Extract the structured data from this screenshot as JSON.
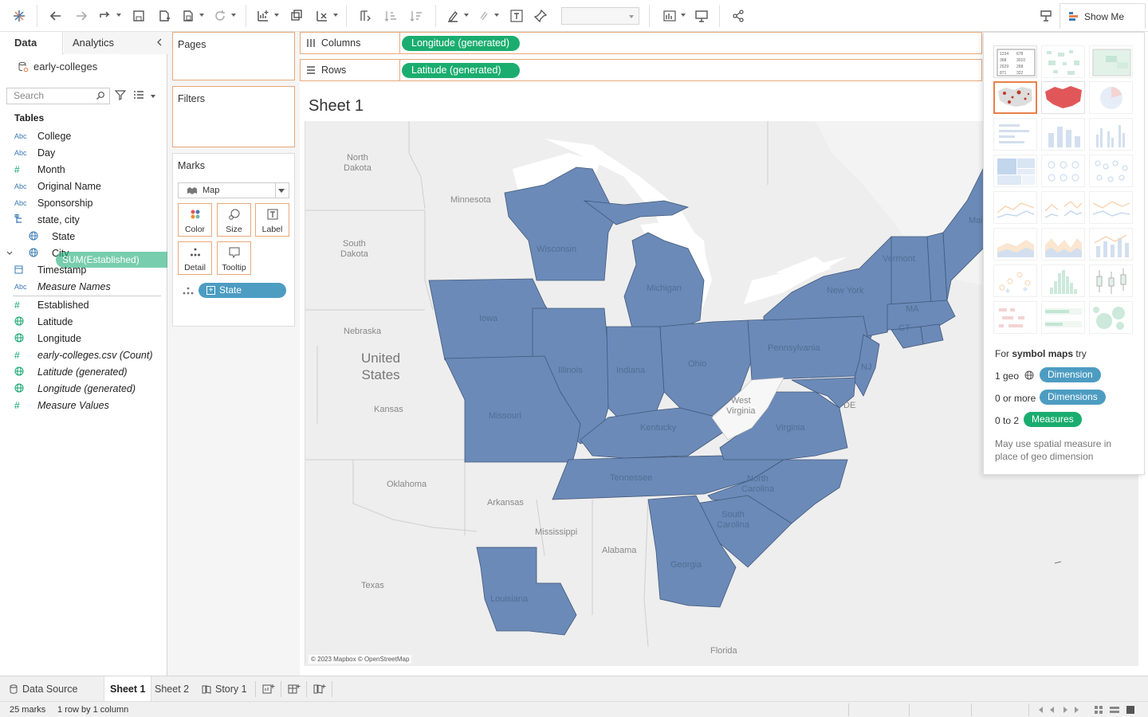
{
  "colors": {
    "accent_orange": "#e8a97a",
    "green_pill": "#1aad6f",
    "blue_pill": "#4d9cc2",
    "state_fill": "#6b8ab8",
    "map_bg": "#eeeeee",
    "water": "#ffffff"
  },
  "toolbar": {
    "show_me_label": "Show Me"
  },
  "data_pane": {
    "tab_data": "Data",
    "tab_analytics": "Analytics",
    "datasource": "early-colleges",
    "search_placeholder": "Search",
    "tables_heading": "Tables",
    "fields": [
      {
        "type": "Abc",
        "name": "College"
      },
      {
        "type": "Abc",
        "name": "Day"
      },
      {
        "type": "#",
        "name": "Month"
      },
      {
        "type": "Abc",
        "name": "Original Name"
      },
      {
        "type": "Abc",
        "name": "Sponsorship"
      },
      {
        "type": "hier",
        "name": "state, city"
      },
      {
        "type": "geo",
        "name": "State"
      },
      {
        "type": "geo",
        "name": "City"
      },
      {
        "type": "date",
        "name": "Timestamp"
      },
      {
        "type": "Abc",
        "name": "Measure Names"
      },
      {
        "type": "#",
        "name": "Established"
      },
      {
        "type": "geo",
        "name": "Latitude"
      },
      {
        "type": "geo",
        "name": "Longitude"
      },
      {
        "type": "#",
        "name": "early-colleges.csv (Count)"
      },
      {
        "type": "geo",
        "name": "Latitude (generated)"
      },
      {
        "type": "geo",
        "name": "Longitude (generated)"
      },
      {
        "type": "#",
        "name": "Measure Values"
      }
    ],
    "drag_pill": "SUM(Established)"
  },
  "cards": {
    "pages": "Pages",
    "filters": "Filters",
    "marks": "Marks",
    "mark_type": "Map",
    "buttons": [
      "Color",
      "Size",
      "Label",
      "Detail",
      "Tooltip"
    ],
    "detail_pill": "State"
  },
  "shelves": {
    "columns_label": "Columns",
    "columns_pill": "Longitude (generated)",
    "rows_label": "Rows",
    "rows_pill": "Latitude (generated)"
  },
  "sheet": {
    "title": "Sheet 1",
    "attribution": "© 2023 Mapbox © OpenStreetMap",
    "labels": {
      "north_dakota": "North\nDakota",
      "south_dakota": "South\nDakota",
      "minnesota": "Minnesota",
      "wisconsin": "Wisconsin",
      "michigan": "Michigan",
      "iowa": "Iowa",
      "nebraska": "Nebraska",
      "united_states": "United\nStates",
      "kansas": "Kansas",
      "illinois": "Illinois",
      "indiana": "Indiana",
      "ohio": "Ohio",
      "missouri": "Missouri",
      "kentucky": "Kentucky",
      "west_virginia": "West\nVirginia",
      "virginia": "Virginia",
      "pennsylvania": "Pennsylvania",
      "new_york": "New York",
      "vermont": "Vermont",
      "maine": "Maine",
      "ma": "MA",
      "ct": "CT",
      "nj": "NJ",
      "de": "DE",
      "tennessee": "Tennessee",
      "north_carolina": "North\nCarolina",
      "south_carolina": "South\nCarolina",
      "georgia": "Georgia",
      "alabama": "Alabama",
      "mississippi": "Mississippi",
      "arkansas": "Arkansas",
      "oklahoma": "Oklahoma",
      "texas": "Texas",
      "louisiana": "Louisiana",
      "florida": "Florida"
    }
  },
  "show_me": {
    "for_prefix": "For",
    "for_bold": "symbol maps",
    "for_suffix": "try",
    "req1_text": "1 geo",
    "req1_pill": "Dimension",
    "req2_text": "0 or more",
    "req2_pill": "Dimensions",
    "req3_text": "0 to 2",
    "req3_pill": "Measures",
    "note": "May use spatial measure in place of geo dimension"
  },
  "bottom_tabs": {
    "data_source": "Data Source",
    "sheet1": "Sheet 1",
    "sheet2": "Sheet 2",
    "story1": "Story 1"
  },
  "status": {
    "marks": "25 marks",
    "rowscols": "1 row by 1 column"
  }
}
